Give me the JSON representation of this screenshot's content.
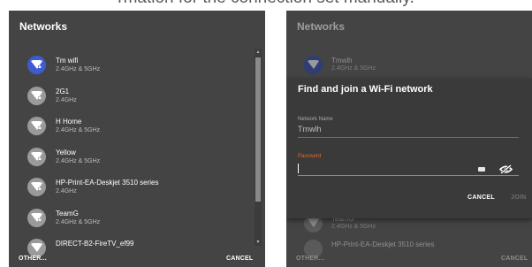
{
  "caption": "rmation for the connection set manually.",
  "left_panel": {
    "title": "Networks",
    "networks": [
      {
        "ssid": "Tm wifi",
        "freq": "2.4GHz & 5GHz",
        "active": true
      },
      {
        "ssid": "2G1",
        "freq": "2.4GHz",
        "active": false
      },
      {
        "ssid": "H Home",
        "freq": "2.4GHz & 5GHz",
        "active": false
      },
      {
        "ssid": "Yellow",
        "freq": "2.4GHz & 5GHz",
        "active": false
      },
      {
        "ssid": "HP-Print-EA-Deskjet 3510 series",
        "freq": "2.4GHz",
        "active": false
      },
      {
        "ssid": "TeamG",
        "freq": "2.4GHz & 5GHz",
        "active": false
      },
      {
        "ssid": "DIRECT-B2-FireTV_ef99",
        "freq": "",
        "active": false
      }
    ],
    "other_label": "OTHER...",
    "cancel_label": "CANCEL",
    "icon": "wifi-lock-icon"
  },
  "right_panel": {
    "title": "Networks",
    "bg_top": {
      "ssid": "Tmwlh",
      "freq": "2.4GHz & 5GHz"
    },
    "bg_bottom": [
      {
        "ssid": "TeamG",
        "freq": "2.4GHz & 5GHz"
      },
      {
        "ssid": "HP-Print-EA-Deskjet 3510 series",
        "freq": ""
      }
    ],
    "other_label": "OTHER...",
    "cancel_label": "CANCEL",
    "dialog": {
      "title": "Find and join a Wi-Fi network",
      "network_name_label": "Network Name",
      "network_name_value": "Tmwlh",
      "password_label": "Password",
      "password_value": "",
      "cancel_label": "CANCEL",
      "join_label": "JOIN"
    }
  },
  "colors": {
    "panel_bg": "#444444",
    "active_badge": "#3f5bd1",
    "accent": "#e86a2a"
  }
}
